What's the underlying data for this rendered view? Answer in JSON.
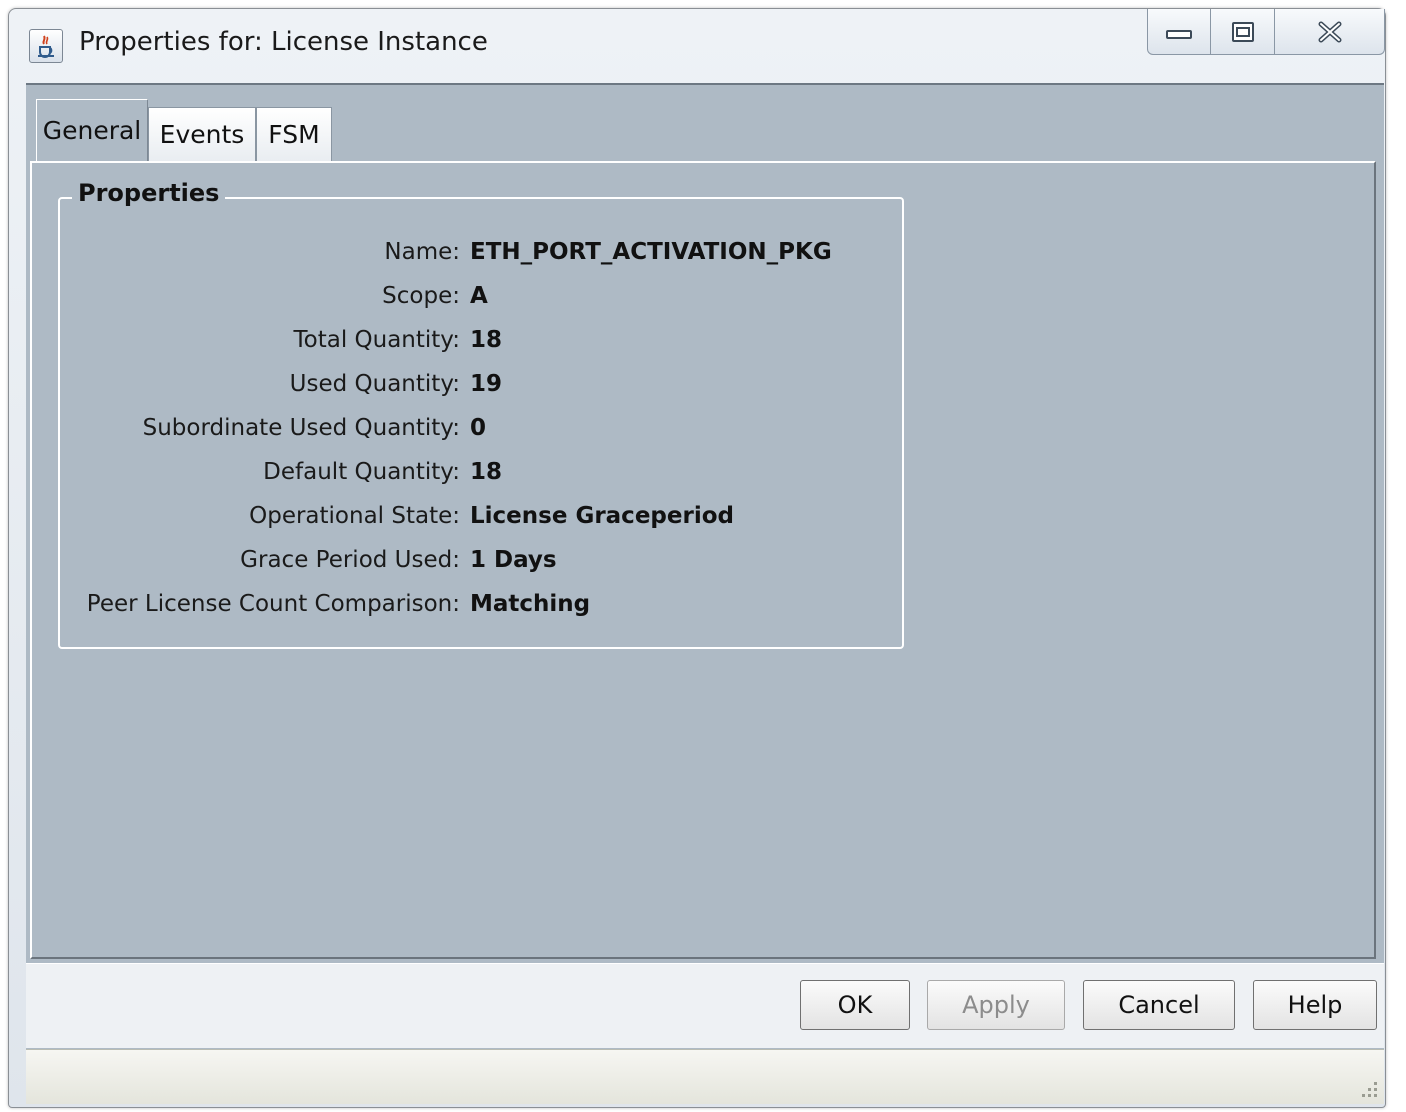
{
  "window": {
    "title": "Properties for: License Instance",
    "icon": "java-cup-icon",
    "controls": [
      "minimize-icon",
      "maximize-icon",
      "close-icon"
    ]
  },
  "tabs": [
    {
      "label": "General",
      "active": true
    },
    {
      "label": "Events",
      "active": false
    },
    {
      "label": "FSM",
      "active": false
    }
  ],
  "properties": {
    "legend": "Properties",
    "rows": [
      {
        "label": "Name:",
        "value": "ETH_PORT_ACTIVATION_PKG"
      },
      {
        "label": "Scope:",
        "value": "A"
      },
      {
        "label": "Total Quantity:",
        "value": "18"
      },
      {
        "label": "Used Quantity:",
        "value": "19"
      },
      {
        "label": "Subordinate Used Quantity:",
        "value": "0"
      },
      {
        "label": "Default Quantity:",
        "value": "18"
      },
      {
        "label": "Operational State:",
        "value": "License Graceperiod"
      },
      {
        "label": "Grace Period Used:",
        "value": "1 Days"
      },
      {
        "label": "Peer License Count Comparison:",
        "value": "Matching"
      }
    ]
  },
  "buttons": {
    "ok": "OK",
    "apply": "Apply",
    "cancel": "Cancel",
    "help": "Help"
  },
  "colors": {
    "panel": "#aebac5",
    "button_bar": "#eef1f4"
  }
}
